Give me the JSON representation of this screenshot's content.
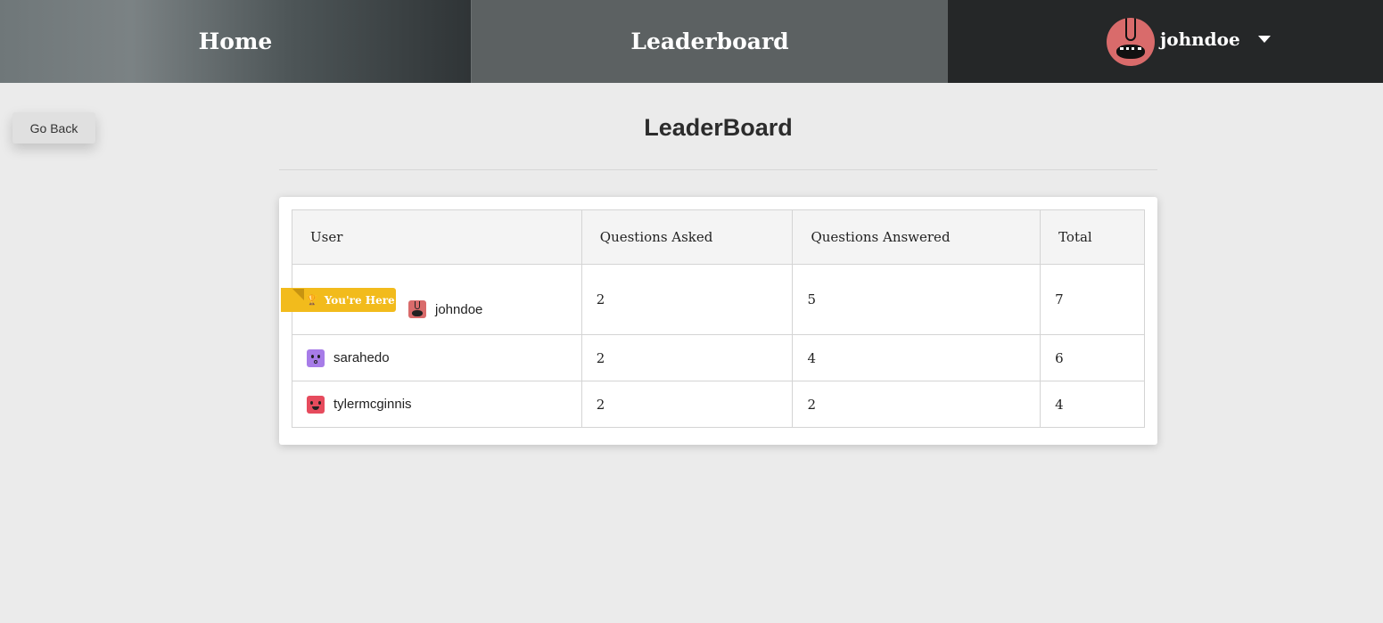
{
  "nav": {
    "home_label": "Home",
    "leaderboard_label": "Leaderboard",
    "username": "johndoe"
  },
  "go_back_label": "Go Back",
  "page_title": "LeaderBoard",
  "table": {
    "headers": [
      "User",
      "Questions Asked",
      "Questions Answered",
      "Total"
    ],
    "rows": [
      {
        "user": "johndoe",
        "asked": "2",
        "answered": "5",
        "total": "7",
        "avatar_color": "#d96b6b"
      },
      {
        "user": "sarahedo",
        "asked": "2",
        "answered": "4",
        "total": "6",
        "avatar_color": "#a77ce8"
      },
      {
        "user": "tylermcginnis",
        "asked": "2",
        "answered": "2",
        "total": "4",
        "avatar_color": "#e64b5d"
      }
    ]
  },
  "ribbon_label": "You're Here",
  "colors": {
    "ribbon": "#f2bb1c",
    "nav_user_bg": "#252728",
    "page_bg": "#ebebeb"
  }
}
